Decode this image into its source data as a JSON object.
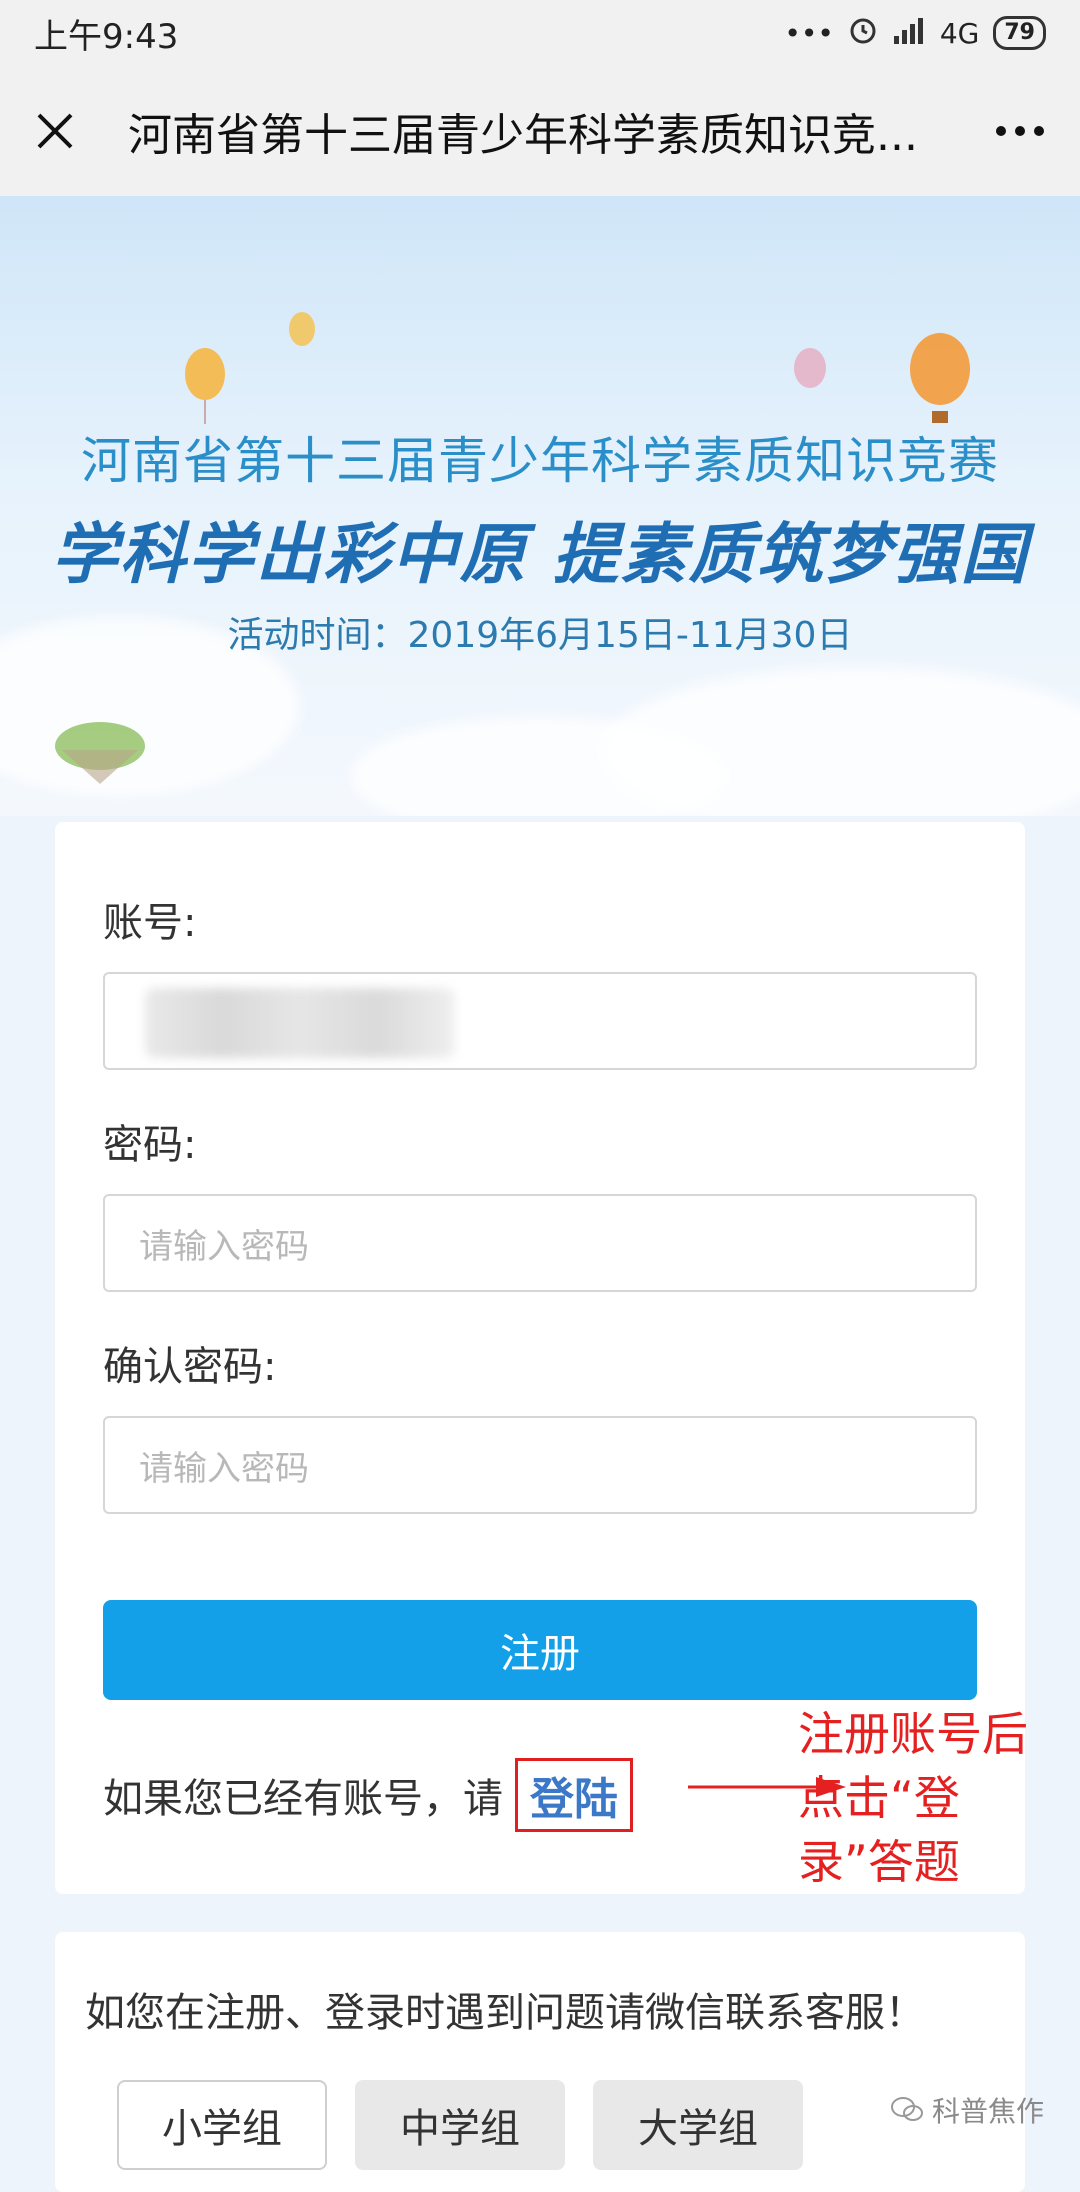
{
  "status_bar": {
    "time": "上午9:43",
    "dots": "•••",
    "network": "4G",
    "battery": "79"
  },
  "title_bar": {
    "title": "河南省第十三届青少年科学素质知识竞...",
    "more": "•••"
  },
  "hero": {
    "title1": "河南省第十三届青少年科学素质知识竞赛",
    "title2": "学科学出彩中原  提素质筑梦强国",
    "date": "活动时间：2019年6月15日-11月30日"
  },
  "form": {
    "account_label": "账号:",
    "account_value": "",
    "password_label": "密码:",
    "password_placeholder": "请输入密码",
    "confirm_label": "确认密码:",
    "confirm_placeholder": "请输入密码",
    "register_label": "注册",
    "login_prompt": "如果您已经有账号，请",
    "login_link": "登陆"
  },
  "annotation": {
    "text": "注册账号后点击“登录”答题",
    "color": "#e52020"
  },
  "help": {
    "text": "如您在注册、登录时遇到问题请微信联系客服！",
    "groups": [
      "小学组",
      "中学组",
      "大学组"
    ],
    "selected": "小学组"
  },
  "watermark": "科普焦作",
  "colors": {
    "accent": "#13a0e8",
    "hero_title": "#1f6db3",
    "annotation": "#e52020"
  }
}
